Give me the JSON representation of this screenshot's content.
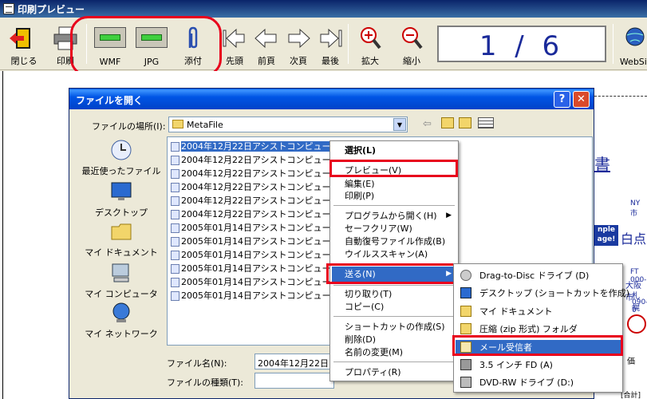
{
  "window": {
    "title": "印刷プレビュー"
  },
  "toolbar": {
    "close": "閉じる",
    "print": "印刷",
    "wmf": "WMF",
    "jpg": "JPG",
    "attach": "添付",
    "first": "先頭",
    "prev": "前頁",
    "next": "次頁",
    "last": "最後",
    "zoom_in": "拡大",
    "zoom_out": "縮小",
    "page_indicator": "1 / 6",
    "website": "WebSit"
  },
  "preview": {
    "title_fragment": "書",
    "lines": [
      "NY市",
      "nple",
      "age!",
      "白点",
      "FT 000-",
      "大阪市",
      "札幌",
      "090-0",
      "価",
      "[合計]"
    ]
  },
  "dialog": {
    "title": "ファイルを開く",
    "look_in_label": "ファイルの場所(I):",
    "look_in_value": "MetaFile",
    "places": [
      "最近使ったファイル",
      "デスクトップ",
      "マイ ドキュメント",
      "マイ コンピュータ",
      "マイ ネットワーク"
    ],
    "files": [
      "2004年12月22日アシストコンピュータ株式会社",
      "2004年12月22日アシストコンピュータ株",
      "2004年12月22日アシストコンピュータ株",
      "2004年12月22日アシストコンピュータ株",
      "2004年12月22日アシストコンピュータ株",
      "2004年12月22日アシストコンピュータ株",
      "2005年01月14日アシストコンピュータ株",
      "2005年01月14日アシストコンピュータ株",
      "2005年01月14日アシストコンピュータ株",
      "2005年01月14日アシストコンピュータ株",
      "2005年01月14日アシストコンピュータ株",
      "2005年01月14日アシストコンピュータ株"
    ],
    "filename_label": "ファイル名(N):",
    "filename_value": "2004年12月22日ア",
    "filetype_label": "ファイルの種類(T):"
  },
  "context_menu": {
    "items": [
      "選択(L)",
      "プレビュー(V)",
      "編集(E)",
      "印刷(P)",
      "プログラムから開く(H)",
      "セーフクリア(W)",
      "自動復号ファイル作成(B)",
      "ウイルススキャン(A)",
      "送る(N)",
      "切り取り(T)",
      "コピー(C)",
      "ショートカットの作成(S)",
      "削除(D)",
      "名前の変更(M)",
      "プロパティ(R)"
    ]
  },
  "sendto_menu": {
    "items": [
      "Drag-to-Disc ドライブ (D)",
      "デスクトップ (ショートカットを作成)",
      "マイ ドキュメント",
      "圧縮 (zip 形式) フォルダ",
      "メール受信者",
      "3.5 インチ FD (A)",
      "DVD-RW ドライブ (D:)"
    ]
  },
  "colors": {
    "highlight": "#316ac5",
    "callout": "#e8001c",
    "title_bar": "#0055e5"
  }
}
